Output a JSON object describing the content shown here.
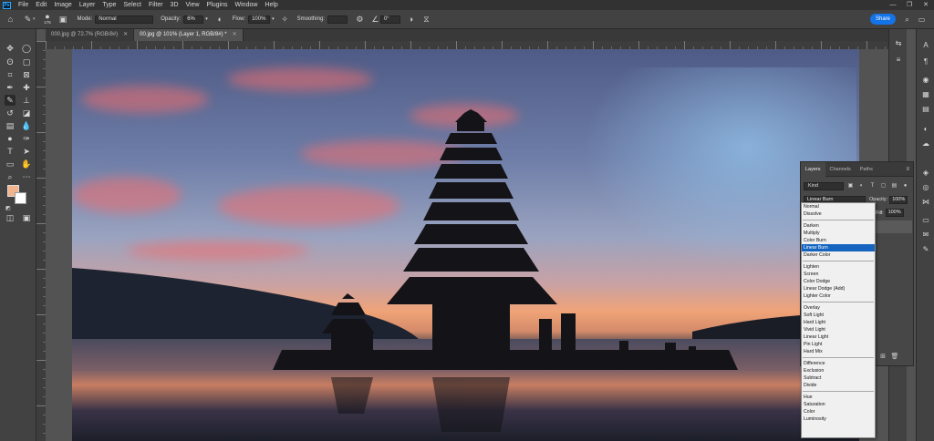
{
  "app": {
    "logo": "Ps",
    "menu": [
      "File",
      "Edit",
      "Image",
      "Layer",
      "Type",
      "Select",
      "Filter",
      "3D",
      "View",
      "Plugins",
      "Window",
      "Help"
    ],
    "window_controls": [
      "—",
      "❐",
      "✕"
    ]
  },
  "options_bar": {
    "brush_size": "175",
    "mode_label": "Mode:",
    "mode_value": "Normal",
    "opacity_label": "Opacity:",
    "opacity_value": "6%",
    "flow_label": "Flow:",
    "flow_value": "100%",
    "smoothing_label": "Smoothing:",
    "smoothing_value": "",
    "angle_value": "0°",
    "share_label": "Share"
  },
  "tabs": [
    {
      "label": "000.jpg @ 72.7% (RGB/8#)",
      "active": false
    },
    {
      "label": "00.jpg @ 101% (Layer 1, RGB/8#) *",
      "active": true
    }
  ],
  "layers_panel": {
    "tabs": [
      "Layers",
      "Channels",
      "Paths"
    ],
    "kind_label": "Kind",
    "blend_mode": "Linear Burn",
    "opacity_label": "Opacity:",
    "opacity_value": "100%",
    "fill_label": "Fill:",
    "fill_value": "100%"
  },
  "blend_modes": [
    [
      "Normal",
      "Dissolve"
    ],
    [
      "Darken",
      "Multiply",
      "Color Burn",
      "Linear Burn",
      "Darker Color"
    ],
    [
      "Lighten",
      "Screen",
      "Color Dodge",
      "Linear Dodge (Add)",
      "Lighter Color"
    ],
    [
      "Overlay",
      "Soft Light",
      "Hard Light",
      "Vivid Light",
      "Linear Light",
      "Pin Light",
      "Hard Mix"
    ],
    [
      "Difference",
      "Exclusion",
      "Subtract",
      "Divide"
    ],
    [
      "Hue",
      "Saturation",
      "Color",
      "Luminosity"
    ]
  ],
  "blend_selected": "Linear Burn",
  "colors": {
    "foreground": "#f2b48c",
    "background": "#ffffff",
    "accent": "#1473e6",
    "selection": "#1565c0"
  }
}
